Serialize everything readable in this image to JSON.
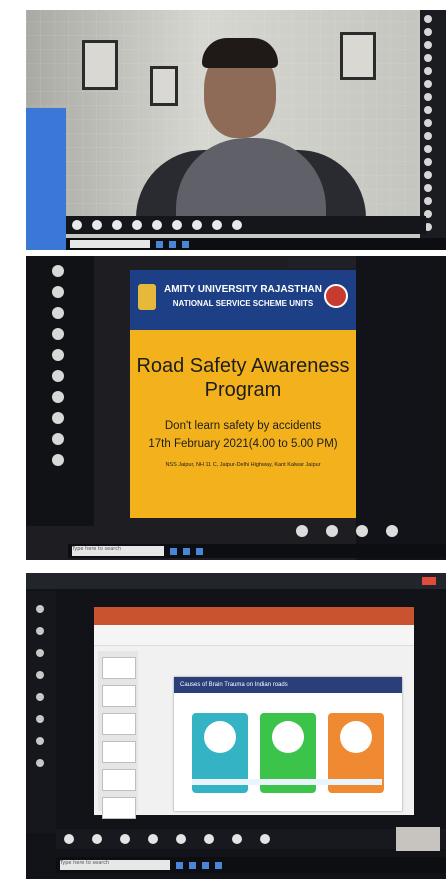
{
  "poster": {
    "institute": "AMITY UNIVERSITY RAJASTHAN",
    "unit": "NATIONAL SERVICE SCHEME UNITS",
    "title_line1": "Road Safety Awareness",
    "title_line2": "Program",
    "tagline": "Don't learn safety by accidents",
    "date": "17th February 2021(4.00 to 5.00 PM)",
    "venue": "NSS Jaipur, NH 11 C, Jaipur-Delhi Highway, Kant Kalwar Jaipur"
  },
  "slide": {
    "title": "Causes of Brain Trauma on Indian roads"
  },
  "taskbar": {
    "search_placeholder": "Type here to search"
  },
  "colors": {
    "poster_bg": "#f3b21c",
    "poster_header": "#1d3f86",
    "ppt_ribbon": "#c9532e",
    "card_teal": "#33b3c4",
    "card_green": "#3cc34a",
    "card_orange": "#f08a32"
  }
}
